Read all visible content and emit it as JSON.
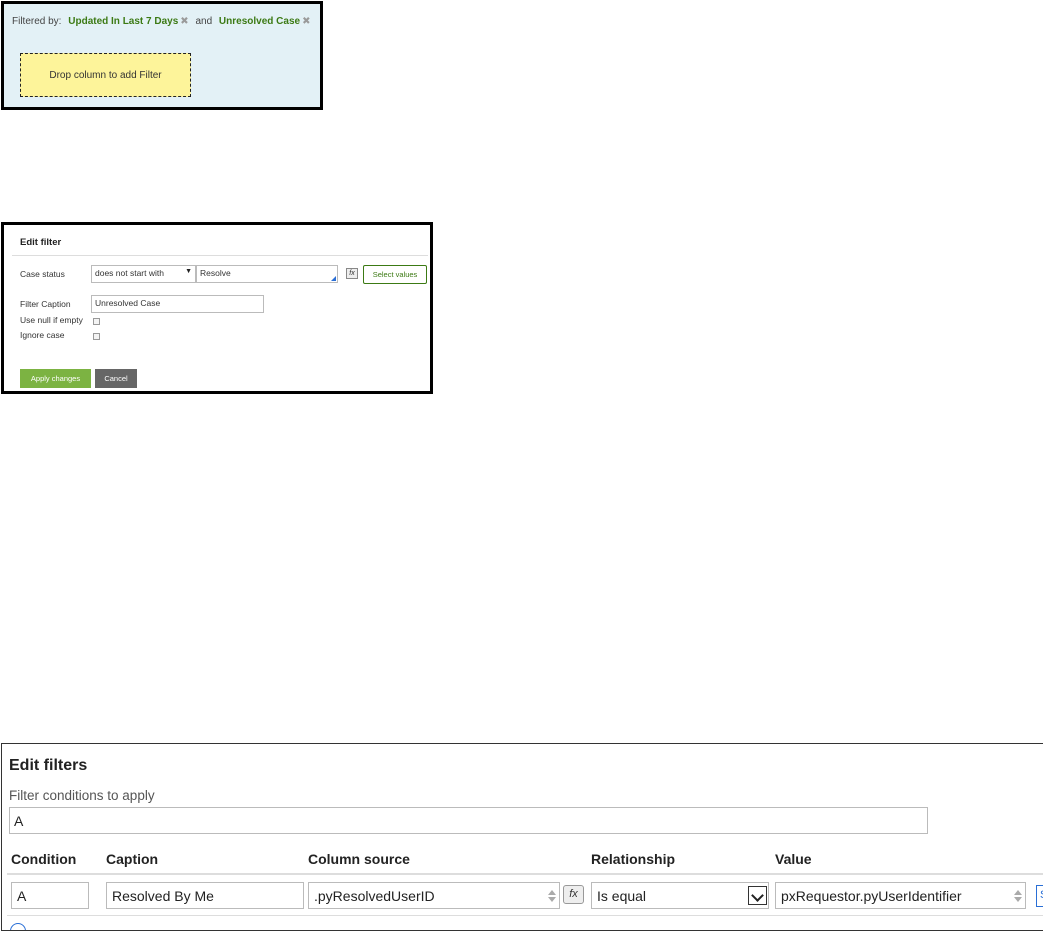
{
  "filter_bar": {
    "prefix": "Filtered by:",
    "filters": [
      {
        "label": "Updated In Last 7 Days",
        "remove": "✖"
      },
      {
        "label": "Unresolved Case",
        "remove": "✖"
      }
    ],
    "joiner": "and",
    "drop_zone": "Drop column to add Filter",
    "colors": {
      "background": "#e3f1f6",
      "tag": "#3c7a14",
      "drop_zone": "#fdf49a"
    }
  },
  "edit_filter": {
    "title": "Edit filter",
    "case_status_label": "Case status",
    "operator": "does not start with",
    "operator_arrow": "▼",
    "value": "Resolve",
    "fx_label": "fx",
    "select_values": "Select values",
    "caption_label": "Filter Caption",
    "caption_value": "Unresolved Case",
    "null_if_empty_label": "Use null if empty",
    "null_if_empty_checked": false,
    "ignore_case_label": "Ignore case",
    "ignore_case_checked": false,
    "apply_label": "Apply changes",
    "cancel_label": "Cancel",
    "colors": {
      "apply": "#7cb342",
      "cancel": "#666666"
    }
  },
  "edit_filters": {
    "title": "Edit filters",
    "conditions_label": "Filter conditions to apply",
    "conditions_value": "A",
    "columns": [
      "Condition",
      "Caption",
      "Column source",
      "Relationship",
      "Value"
    ],
    "rows": [
      {
        "condition": "A",
        "caption": "Resolved By Me",
        "column_source": ".pyResolvedUserID",
        "relationship": "Is equal",
        "value": "pxRequestor.pyUserIdentifier"
      }
    ],
    "fx_label": "fx",
    "cut_button_text": "S"
  }
}
